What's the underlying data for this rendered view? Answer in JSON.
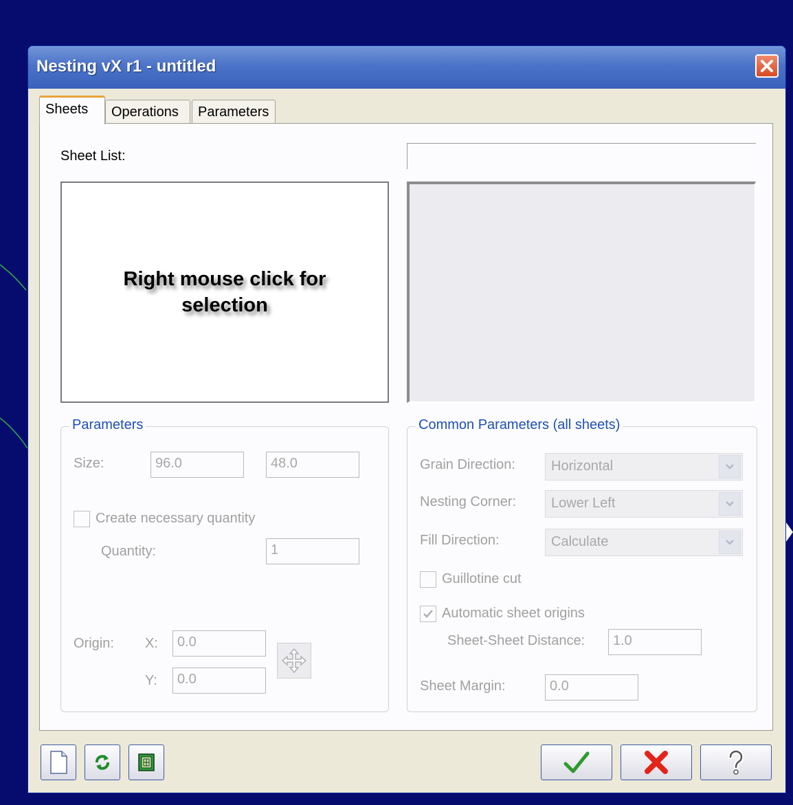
{
  "window": {
    "title": "Nesting vX r1 - untitled"
  },
  "tabs": [
    {
      "label": "Sheets",
      "active": true
    },
    {
      "label": "Operations",
      "active": false
    },
    {
      "label": "Parameters",
      "active": false
    }
  ],
  "sheets_tab": {
    "sheet_list_label": "Sheet List:",
    "sheet_list_hint": "Right mouse click for selection",
    "sheet_name_value": ""
  },
  "parameters_group": {
    "title": "Parameters",
    "size_label": "Size:",
    "size_width": "96.0",
    "size_height": "48.0",
    "create_quantity_label": "Create necessary quantity",
    "create_quantity_checked": false,
    "quantity_label": "Quantity:",
    "quantity_value": "1",
    "origin_label": "Origin:",
    "x_label": "X:",
    "x_value": "0.0",
    "y_label": "Y:",
    "y_value": "0.0"
  },
  "common_group": {
    "title": "Common Parameters (all sheets)",
    "grain_label": "Grain Direction:",
    "grain_value": "Horizontal",
    "corner_label": "Nesting Corner:",
    "corner_value": "Lower Left",
    "fill_label": "Fill Direction:",
    "fill_value": "Calculate",
    "guillotine_label": "Guillotine cut",
    "guillotine_checked": false,
    "auto_origins_label": "Automatic sheet origins",
    "auto_origins_checked": true,
    "distance_label": "Sheet-Sheet Distance:",
    "distance_value": "1.0",
    "margin_label": "Sheet Margin:",
    "margin_value": "0.0"
  },
  "colors": {
    "desktop": "#050c6e",
    "titlebar": "#4b73c8",
    "group_title": "#1f4fb4",
    "ok_check": "#2f9a2f",
    "cancel_x": "#e2241a",
    "tab_highlight": "#e8a33c"
  },
  "icons": {
    "close": "close-icon",
    "new_sheet": "new-document-icon",
    "refresh": "refresh-icon",
    "sheet_tool": "sheet-material-icon",
    "ok": "checkmark-icon",
    "cancel": "cancel-x-icon",
    "help": "question-mark-icon",
    "pan": "move-arrows-icon"
  }
}
